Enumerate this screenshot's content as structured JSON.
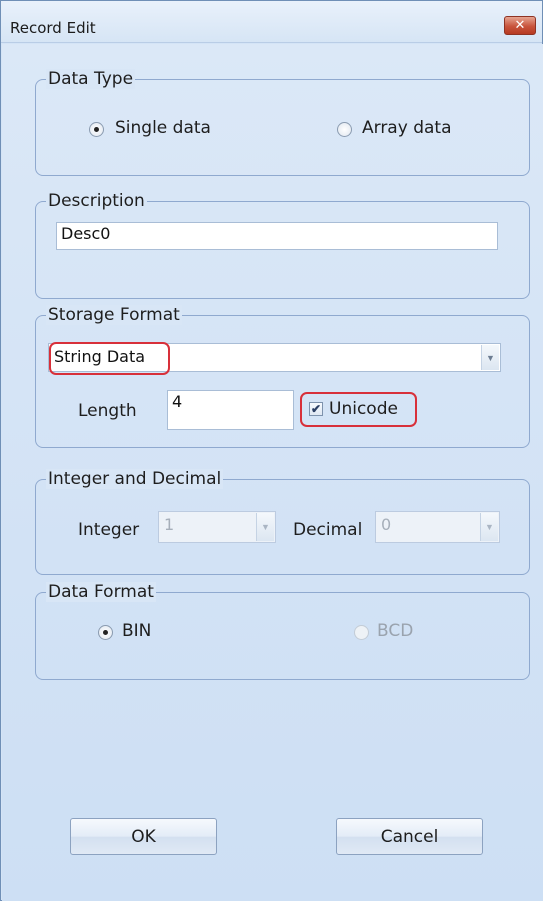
{
  "window": {
    "title": "Record Edit",
    "close_glyph": "✕"
  },
  "data_type": {
    "legend": "Data Type",
    "options": [
      "Single data",
      "Array data"
    ],
    "selected": "Single data"
  },
  "description": {
    "legend": "Description",
    "value": "Desc0"
  },
  "storage_format": {
    "legend": "Storage Format",
    "format_value": "String Data",
    "length_label": "Length",
    "length_value": "4",
    "unicode_label": "Unicode",
    "unicode_checked": true
  },
  "integer_decimal": {
    "legend": "Integer and Decimal",
    "integer_label": "Integer",
    "integer_value": "1",
    "decimal_label": "Decimal",
    "decimal_value": "0"
  },
  "data_format": {
    "legend": "Data Format",
    "options": [
      "BIN",
      "BCD"
    ],
    "selected": "BIN"
  },
  "buttons": {
    "ok": "OK",
    "cancel": "Cancel"
  },
  "colors": {
    "highlight": "#d8303a",
    "close_button": "#c8543c"
  }
}
